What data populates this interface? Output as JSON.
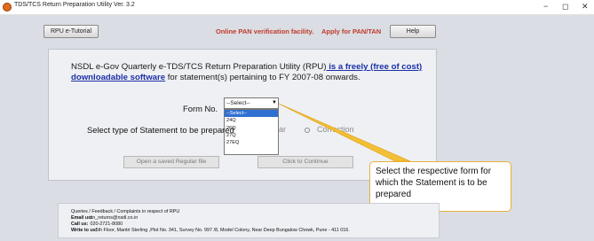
{
  "window": {
    "title": "TDS/TCS Return Preparation Utility Ver. 3.2",
    "minimize": "−",
    "maximize": "◻",
    "close": "✕"
  },
  "toolbar": {
    "tutorial_label": "RPU e-Tutorial",
    "pan_link": "Online PAN verification facility.",
    "apply_link": "Apply for PAN/TAN",
    "help_label": "Help"
  },
  "intro": {
    "prefix": "NSDL e-Gov Quarterly e-TDS/TCS Return Preparation Utility (RPU)",
    "highlight": " is a freely (free of cost) downloadable software",
    "suffix": "  for statement(s) pertaining to FY 2007-08 onwards."
  },
  "form": {
    "label": "Form No.",
    "selected": "--Select--",
    "options": [
      "--Select--",
      "24Q",
      "26Q",
      "27Q",
      "27EQ"
    ]
  },
  "statement": {
    "label": "Select type of Statement to be prepared",
    "regular_fragment": "ar",
    "correction_label": "Correction"
  },
  "buttons": {
    "open_saved": "Open a saved Regular file",
    "continue": "Click to Continue"
  },
  "callout": {
    "text": "Select the respective form for which the Statement is to be prepared"
  },
  "footer": {
    "heading": "Queries / Feedback / Complaints in respect of RPU",
    "email_key": "Email us:",
    "email_value": "tin_returns@nsdl.co.in",
    "call_key": "Call us:",
    "call_value": "020-2721-8080",
    "write_key": "Write to us:",
    "write_value": "5th Floor, Mantri Sterling ,Plot No. 341, Survey No. 997 /8, Model Colony, Near Deep Bungalow Chowk, Pune - 411 016."
  },
  "colors": {
    "callout_border": "#e5b13a",
    "arrow": "#f2c037",
    "link": "#c0392b",
    "highlight": "#1b2fa6"
  }
}
